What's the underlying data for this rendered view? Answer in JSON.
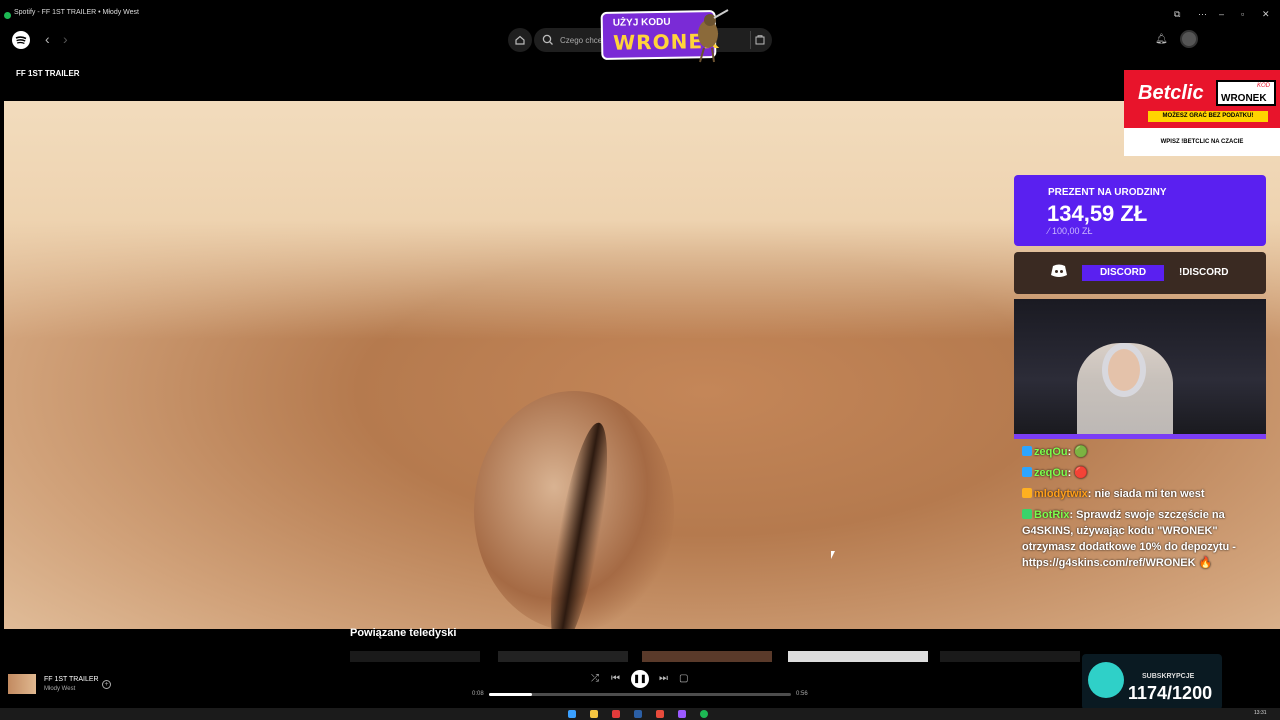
{
  "window": {
    "title": "Spotify - FF 1ST TRAILER • Młody West"
  },
  "titlebar_icons": [
    "minimize-icon",
    "maximize-icon",
    "close-icon"
  ],
  "search": {
    "placeholder": "Czego chcesz posłuchać?",
    "visible_text": "Czego chce"
  },
  "promo": {
    "line1": "UŻYJ KODU",
    "line2": "WRONEK"
  },
  "page": {
    "title": "FF 1ST TRAILER"
  },
  "overlay": {
    "betclic": {
      "logo": "Betclic",
      "kod_small": "KOD",
      "kod": "WRONEK",
      "bar": "MOŻESZ GRAĆ BEZ PODATKU!",
      "bottom": "WPISZ !BETCLIC NA CZACIE"
    },
    "goal": {
      "title": "PREZENT NA URODZINY",
      "value": "134,59 ZŁ",
      "target": "⁄ 100,00 ZŁ"
    },
    "discord": {
      "label": "DISCORD",
      "command": "!DISCORD"
    },
    "chat": [
      {
        "user": "zeqOu",
        "sep": ":",
        "text": " 🟢",
        "color": "green"
      },
      {
        "user": "zeqOu",
        "sep": ":",
        "text": " 🔴",
        "color": "green"
      },
      {
        "user": "mlodytwix",
        "sep": ":",
        "text": " nie siada mi ten west",
        "color": "orange"
      },
      {
        "user": "BotRix",
        "sep": ":",
        "text": " Sprawdź swoje szczęście na G4SKINS, używając kodu \"WRONEK\" otrzymasz dodatkowe 10% do depozytu - https://g4skins.com/ref/WRONEK 🔥",
        "color": "green"
      }
    ],
    "subs": {
      "label": "SUBSKRYPCJE",
      "count": "1174/1200"
    }
  },
  "related": {
    "title": "Powiązane teledyski"
  },
  "player": {
    "track_title": "FF 1ST TRAILER",
    "artist": "Młody West",
    "time_current": "0:08",
    "time_total": "0:56",
    "progress_fraction": 0.143,
    "add_symbol": "+",
    "shuffle": "⤮",
    "prev": "⏮",
    "pause": "❚❚",
    "next": "⏭",
    "lyrics": "▢"
  },
  "clock": "13:31",
  "colors": {
    "accent_purple": "#5a20f0",
    "spotify_green": "#1db954",
    "betclic_red": "#e8142b"
  }
}
